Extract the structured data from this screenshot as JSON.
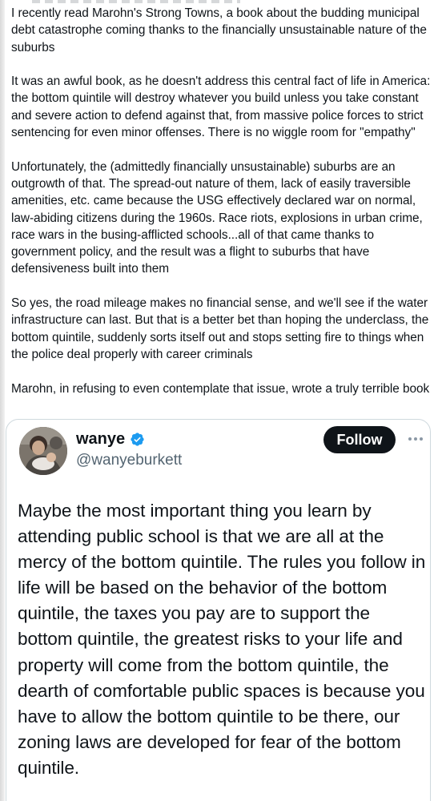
{
  "post": {
    "paragraphs": [
      "I recently read Marohn's Strong Towns, a book about the budding municipal debt catastrophe coming thanks to the financially unsustainable nature of the suburbs",
      "It was an awful book, as he doesn't address this central fact of life in America: the bottom quintile will destroy whatever you build unless you take constant and severe action to defend against that, from massive police forces to strict sentencing for even minor offenses. There is no wiggle room for \"empathy\"",
      "Unfortunately, the (admittedly financially unsustainable) suburbs are an outgrowth of that. The spread-out nature of them, lack of easily traversible amenities, etc. came because the USG effectively declared war on normal, law-abiding citizens during the 1960s. Race riots, explosions in urban crime, race wars in the busing-afflicted schools...all of that came thanks to government  policy, and the result was a flight to suburbs that have defensiveness built into them",
      "So yes, the road mileage makes no financial sense, and we'll see if the water infrastructure can last. But that is a better bet than hoping the underclass, the bottom quintile, suddenly sorts itself out and stops setting fire to things when the police deal properly with career criminals",
      "Marohn, in refusing to even contemplate that issue, wrote a truly terrible book"
    ]
  },
  "quote": {
    "display_name": "wanye",
    "handle": "@wanyeburkett",
    "verified_icon": "verified-badge-icon",
    "follow_label": "Follow",
    "more_icon": "more-options-icon",
    "text": "Maybe the most important thing you learn by attending public school is that we are all at the mercy of the bottom quintile. The rules you follow in life will be based on the behavior of the bottom quintile, the taxes you pay are to support the bottom quintile, the greatest risks to your life and property will come from the bottom quintile, the dearth of comfortable public spaces is because you have to allow the bottom quintile to be there, our zoning laws are developed for fear of the bottom quintile."
  },
  "colors": {
    "text": "#0f1419",
    "secondary_text": "#536471",
    "verified_blue": "#1d9bf0",
    "follow_bg": "#0f1419",
    "card_border": "#cfd9de"
  }
}
